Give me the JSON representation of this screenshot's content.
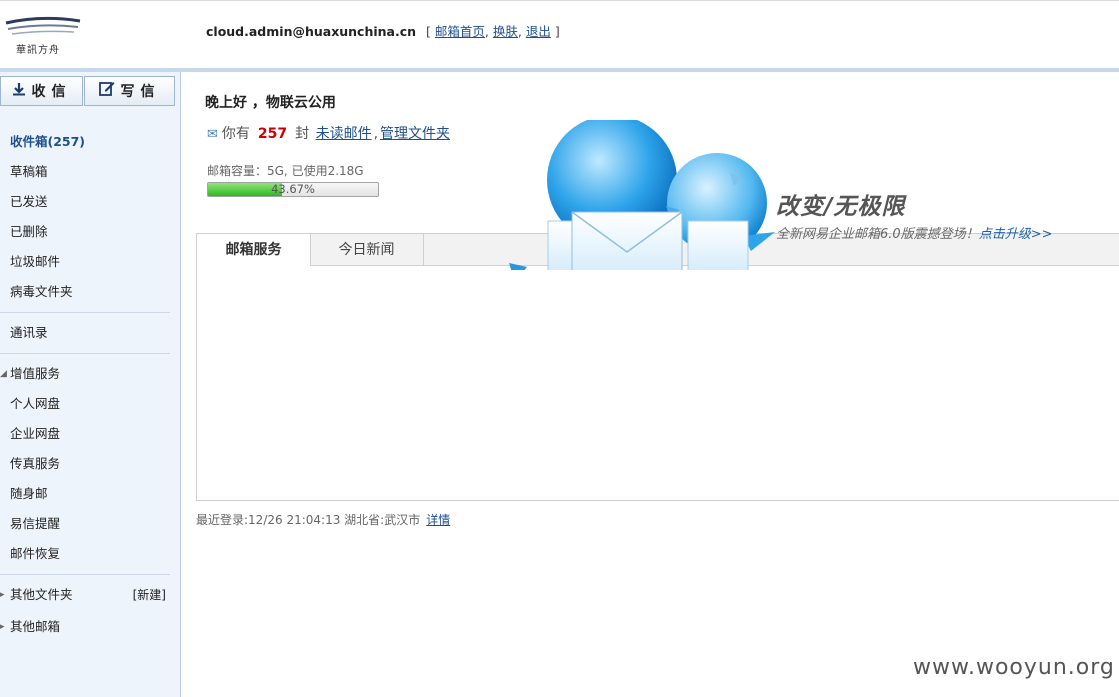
{
  "header": {
    "logo_text": "華訊方舟",
    "user_email": "cloud.admin@huaxunchina.cn",
    "links": [
      "邮箱首页",
      "换肤",
      "退出"
    ]
  },
  "sidebar": {
    "receive_label": "收信",
    "compose_label": "写信",
    "folders": [
      {
        "label": "收件箱(257)",
        "active": true
      },
      {
        "label": "草稿箱"
      },
      {
        "label": "已发送"
      },
      {
        "label": "已删除"
      },
      {
        "label": "垃圾邮件"
      },
      {
        "label": "病毒文件夹"
      }
    ],
    "contacts": "通讯录",
    "services_header": "增值服务",
    "services": [
      "个人网盘",
      "企业网盘",
      "传真服务",
      "随身邮",
      "易信提醒",
      "邮件恢复"
    ],
    "other_folders": "其他文件夹",
    "new_folder": "[新建]",
    "other_mailboxes": "其他邮箱"
  },
  "main": {
    "greeting": "晚上好 ，物联云公用",
    "you_have": "你有",
    "unread_count": "257",
    "unit": "封",
    "unread_link": "未读邮件",
    "manage_link": "管理文件夹",
    "quota_label": "邮箱容量：5G, 已使用2.18G",
    "quota_percent_text": "43.67%",
    "quota_fraction": 0.4367,
    "tabs": [
      "邮箱服务",
      "今日新闻"
    ],
    "promo_title": "改变/无极限",
    "promo_sub": "全新网易企业邮箱6.0版震撼登场！",
    "promo_link": "点击升级>>",
    "last_login": "最近登录:12/26 21:04:13  湖北省:武汉市",
    "details_link": "详情"
  },
  "watermark": "www.wooyun.org",
  "colors": {
    "sidebar_bg": "#eef4fb",
    "link": "#1f4f8f",
    "unread_count": "#cc0000",
    "progress_fill": "#2fb81f"
  }
}
